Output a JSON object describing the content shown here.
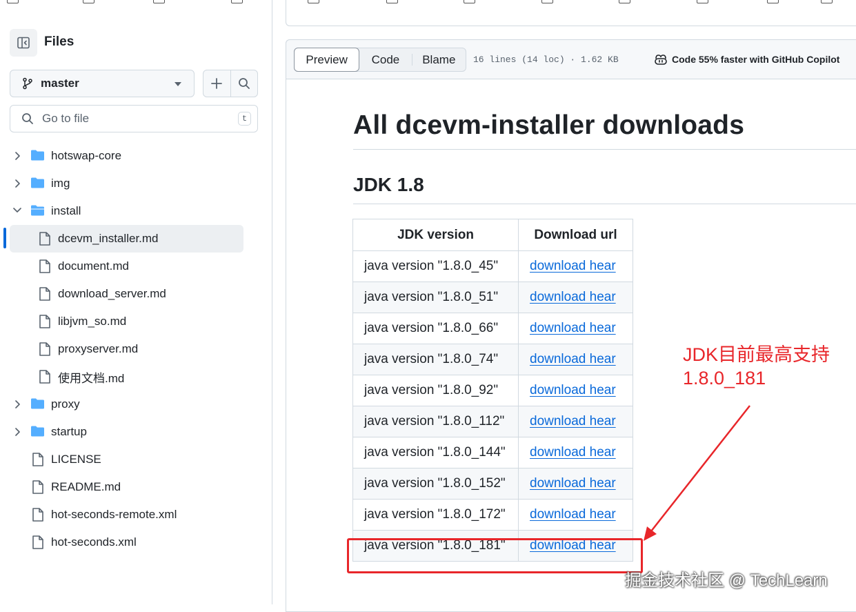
{
  "sidebar": {
    "title": "Files",
    "branch": "master",
    "goto_placeholder": "Go to file",
    "goto_shortcut": "t",
    "items": [
      {
        "label": "hotswap-core",
        "type": "folder",
        "expanded": false
      },
      {
        "label": "img",
        "type": "folder",
        "expanded": false
      },
      {
        "label": "install",
        "type": "folder",
        "expanded": true
      },
      {
        "label": "dcevm_installer.md",
        "type": "file",
        "selected": true
      },
      {
        "label": "document.md",
        "type": "file"
      },
      {
        "label": "download_server.md",
        "type": "file"
      },
      {
        "label": "libjvm_so.md",
        "type": "file"
      },
      {
        "label": "proxyserver.md",
        "type": "file"
      },
      {
        "label": "使用文档.md",
        "type": "file"
      },
      {
        "label": "proxy",
        "type": "folder",
        "expanded": false
      },
      {
        "label": "startup",
        "type": "folder",
        "expanded": false
      },
      {
        "label": "LICENSE",
        "type": "file"
      },
      {
        "label": "README.md",
        "type": "file"
      },
      {
        "label": "hot-seconds-remote.xml",
        "type": "file"
      },
      {
        "label": "hot-seconds.xml",
        "type": "file"
      }
    ]
  },
  "file_header": {
    "tabs": [
      "Preview",
      "Code",
      "Blame"
    ],
    "active_tab": "Preview",
    "meta": "16 lines (14 loc) · 1.62 KB",
    "copilot": "Code 55% faster with GitHub Copilot"
  },
  "content": {
    "title": "All dcevm-installer downloads",
    "section": "JDK 1.8",
    "table": {
      "headers": [
        "JDK version",
        "Download url"
      ],
      "rows": [
        [
          "java version \"1.8.0_45\"",
          "download hear"
        ],
        [
          "java version \"1.8.0_51\"",
          "download hear"
        ],
        [
          "java version \"1.8.0_66\"",
          "download hear"
        ],
        [
          "java version \"1.8.0_74\"",
          "download hear"
        ],
        [
          "java version \"1.8.0_92\"",
          "download hear"
        ],
        [
          "java version \"1.8.0_112\"",
          "download hear"
        ],
        [
          "java version \"1.8.0_144\"",
          "download hear"
        ],
        [
          "java version \"1.8.0_152\"",
          "download hear"
        ],
        [
          "java version \"1.8.0_172\"",
          "download hear"
        ],
        [
          "java version \"1.8.0_181\"",
          "download hear"
        ]
      ]
    }
  },
  "annotation": {
    "note": "JDK目前最高支持\n1.8.0_181",
    "color": "#e8262a"
  },
  "watermark": "掘金技术社区 @ TechLearn",
  "colors": {
    "link": "#0969da",
    "folder": "#54aeff",
    "border": "#d1d9e0",
    "accent": "#0969da"
  }
}
